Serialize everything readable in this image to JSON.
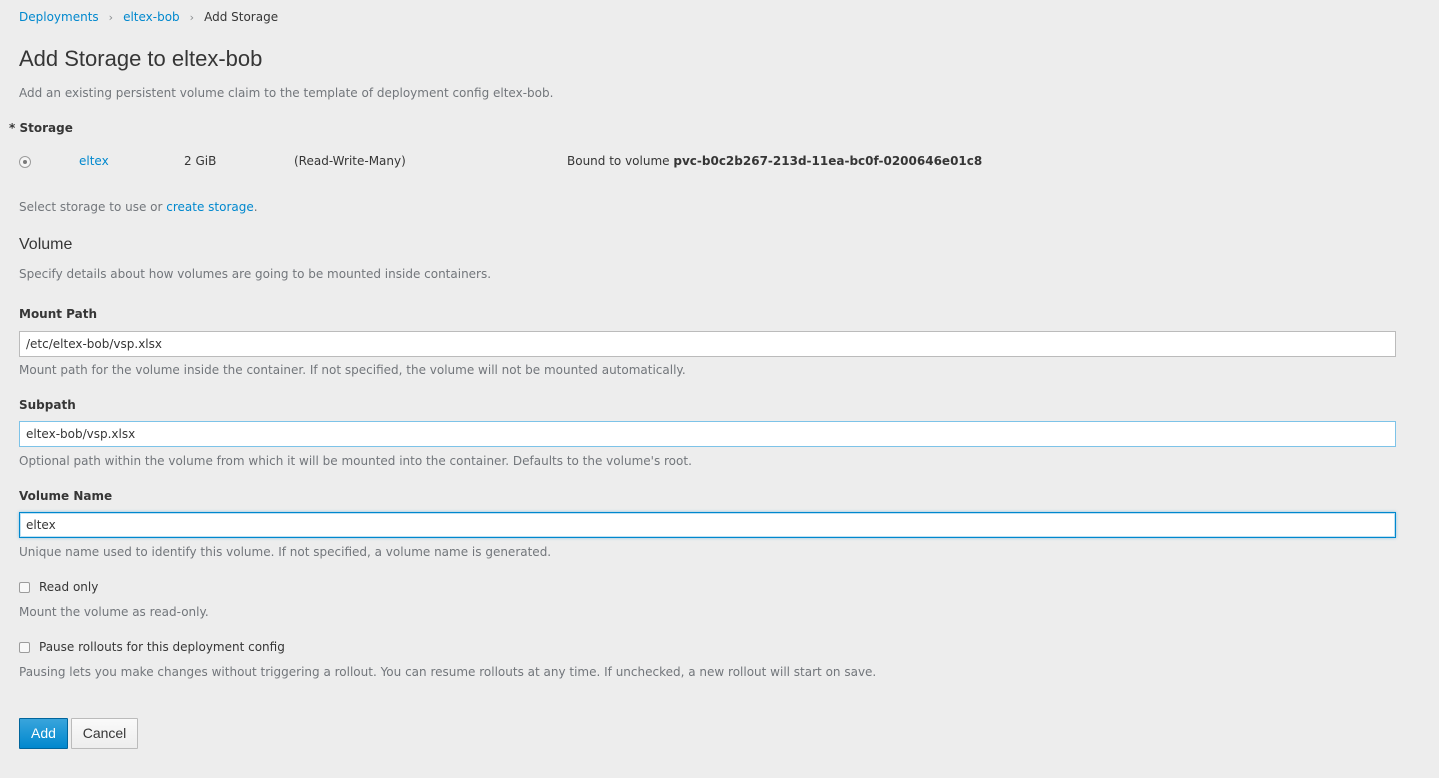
{
  "breadcrumb": {
    "items": [
      "Deployments",
      "eltex-bob"
    ],
    "separator": "›",
    "current": "Add Storage"
  },
  "page": {
    "title": "Add Storage to eltex-bob",
    "description": "Add an existing persistent volume claim to the template of deployment config eltex-bob."
  },
  "storage": {
    "label": "Storage",
    "required_marker": "*",
    "claims": [
      {
        "name": "eltex",
        "size": "2 GiB",
        "access_mode": "(Read-Write-Many)",
        "bound_prefix": "Bound to volume",
        "volume": "pvc-b0c2b267-213d-11ea-bc0f-0200646e01c8",
        "selected": true
      }
    ],
    "help_prefix": "Select storage to use or",
    "help_link": "create storage",
    "help_suffix": "."
  },
  "volume": {
    "title": "Volume",
    "description": "Specify details about how volumes are going to be mounted inside containers.",
    "mount_path": {
      "label": "Mount Path",
      "value": "/etc/eltex-bob/vsp.xlsx",
      "help": "Mount path for the volume inside the container. If not specified, the volume will not be mounted automatically."
    },
    "subpath": {
      "label": "Subpath",
      "value": "eltex-bob/vsp.xlsx",
      "help": "Optional path within the volume from which it will be mounted into the container. Defaults to the volume's root."
    },
    "volume_name": {
      "label": "Volume Name",
      "value": "eltex",
      "help": "Unique name used to identify this volume. If not specified, a volume name is generated."
    },
    "read_only": {
      "label": "Read only",
      "checked": false,
      "help": "Mount the volume as read-only."
    },
    "pause_rollouts": {
      "label": "Pause rollouts for this deployment config",
      "checked": false,
      "help": "Pausing lets you make changes without triggering a rollout. You can resume rollouts at any time. If unchecked, a new rollout will start on save."
    }
  },
  "actions": {
    "add_label": "Add",
    "cancel_label": "Cancel"
  },
  "colors": {
    "background": "#ededed",
    "link": "#0088ce",
    "primary": "#0088ce",
    "muted_text": "#72767b"
  }
}
